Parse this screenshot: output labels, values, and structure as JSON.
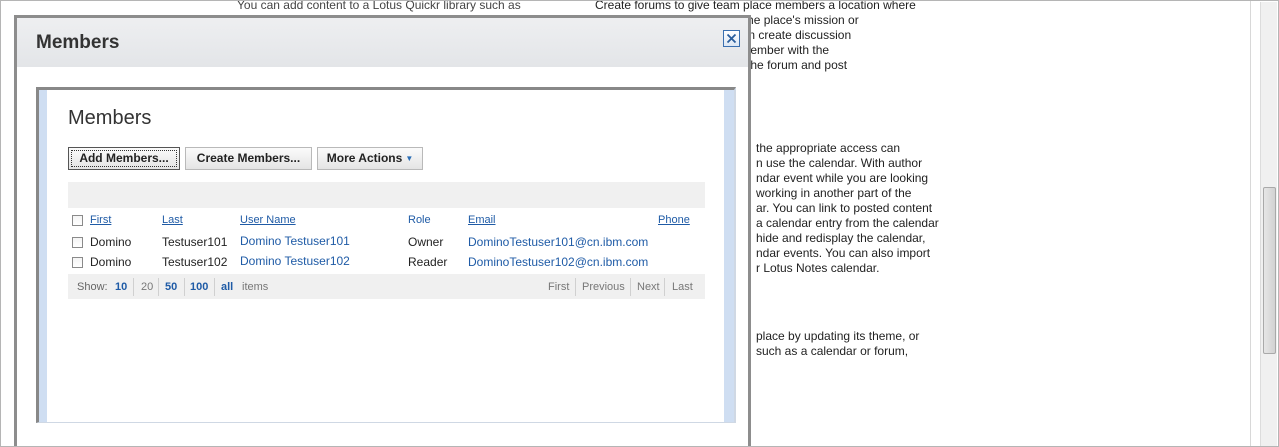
{
  "background": {
    "col1": [
      "You can add content to a Lotus Quickr library such as"
    ],
    "col2": [
      "Create forums to give team place members a location where",
      "                              aining to the place's mission or",
      "                              anager can create discussion",
      "                              m place member with the",
      "                              a topic to the forum and post"
    ],
    "col3": [
      "the appropriate access can",
      "n use the calendar. With author",
      "ndar event while you are looking",
      "working in another part of the",
      "ar. You can link to posted content",
      "a calendar entry from the calendar",
      "hide and redisplay the calendar,",
      "ndar events. You can also import",
      "r Lotus Notes calendar."
    ],
    "col4": [
      "place by updating its theme, or",
      "such as a calendar or forum,"
    ]
  },
  "dialog": {
    "title": "Members",
    "close_icon": "close-icon",
    "heading": "Members",
    "buttons": {
      "add": "Add Members...",
      "create": "Create Members...",
      "more": "More Actions"
    },
    "table": {
      "columns": [
        "First",
        "Last",
        "User Name",
        "Role",
        "Email",
        "Phone"
      ],
      "rows": [
        {
          "first": "Domino",
          "last": "Testuser101",
          "user_name": "Domino Testuser101",
          "role": "Owner",
          "email": "DominoTestuser101@cn.ibm.com",
          "phone": ""
        },
        {
          "first": "Domino",
          "last": "Testuser102",
          "user_name": "Domino Testuser102",
          "role": "Reader",
          "email": "DominoTestuser102@cn.ibm.com",
          "phone": ""
        }
      ]
    },
    "pager": {
      "show_label": "Show:",
      "sizes": [
        "10",
        "20",
        "50",
        "100",
        "all"
      ],
      "selected_size": "20",
      "items_label": "items",
      "first": "First",
      "previous": "Previous",
      "next": "Next",
      "last": "Last"
    }
  },
  "colors": {
    "link": "#1f5ba6",
    "dialog_header": "#e3e5e8",
    "frame_border": "#8d8d8d",
    "inner_frame_blue": "#cfdef2"
  }
}
